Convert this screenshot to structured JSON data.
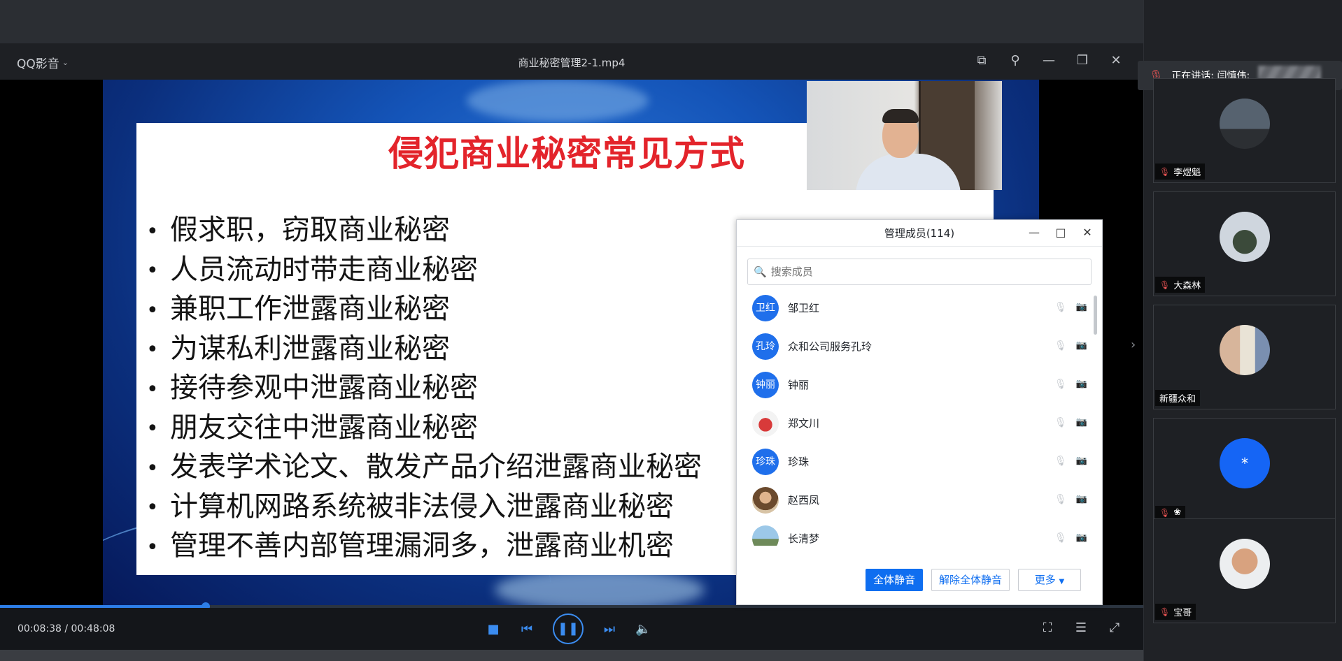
{
  "player": {
    "brand": "QQ影音",
    "file_title": "商业秘密管理2-1.mp4",
    "time_current": "00:08:38",
    "time_separator": " / ",
    "time_total": "00:48:08",
    "progress_fraction": 0.18
  },
  "slide": {
    "title": "侵犯商业秘密常见方式",
    "bullets": [
      "假求职，窃取商业秘密",
      "人员流动时带走商业秘密",
      "兼职工作泄露商业秘密",
      "为谋私利泄露商业秘密",
      "接待参观中泄露商业秘密",
      "朋友交往中泄露商业秘密",
      "发表学术论文、散发产品介绍泄露商业秘密",
      "计算机网路系统被非法侵入泄露商业秘密",
      "管理不善内部管理漏洞多，泄露商业机密"
    ]
  },
  "dialog": {
    "title": "管理成员(114)",
    "search_placeholder": "搜索成员",
    "members": [
      {
        "avatar_text": "卫红",
        "name": "邹卫红"
      },
      {
        "avatar_text": "孔玲",
        "name": "众和公司服务孔玲"
      },
      {
        "avatar_text": "钟丽",
        "name": "钟丽"
      },
      {
        "avatar_text": "",
        "name": "郑文川"
      },
      {
        "avatar_text": "珍珠",
        "name": "珍珠"
      },
      {
        "avatar_text": "",
        "name": "赵西凤"
      },
      {
        "avatar_text": "",
        "name": "长清梦"
      }
    ],
    "mute_all": "全体静音",
    "unmute_all": "解除全体静音",
    "more": "更多"
  },
  "right_panel": {
    "speaking_label": "正在讲话: 闫慎伟;",
    "tiles": [
      {
        "name": "李煜魁"
      },
      {
        "name": "大森林"
      },
      {
        "name": "新疆众和"
      },
      {
        "avatar_text": "*",
        "name": "❀"
      },
      {
        "name": "宝哥"
      }
    ]
  },
  "colors": {
    "accent": "#0f6ef0",
    "slide_title": "#e3242b",
    "muted_red": "#e55353"
  }
}
